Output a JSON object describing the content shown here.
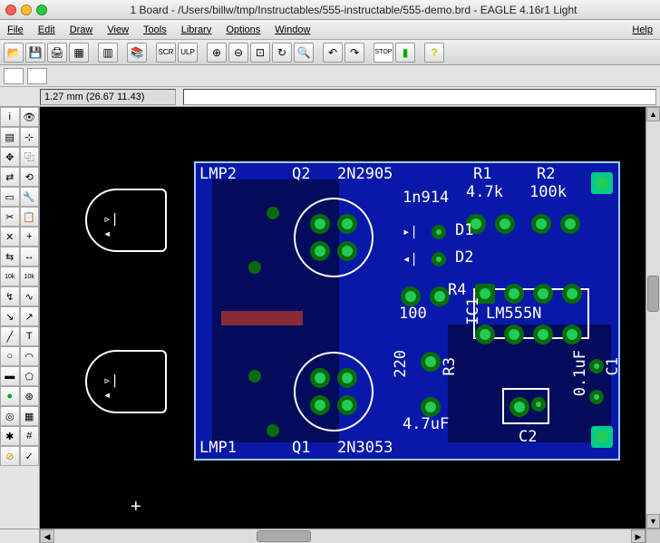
{
  "title": "1 Board - /Users/billw/tmp/Instructables/555-instructable/555-demo.brd - EAGLE 4.16r1 Light",
  "menu": {
    "file": "File",
    "edit": "Edit",
    "draw": "Draw",
    "view": "View",
    "tools": "Tools",
    "library": "Library",
    "options": "Options",
    "window": "Window",
    "help": "Help"
  },
  "coord": "1.27 mm (26.67 11.43)",
  "labels": {
    "lmp2": "LMP2",
    "lmp1": "LMP1",
    "q2": "Q2",
    "q2val": "2N2905",
    "q1": "Q1",
    "q1val": "2N3053",
    "r1": "R1",
    "r1val": "4.7k",
    "r2": "R2",
    "r2val": "100k",
    "r3": "R3",
    "r3val": "4.7uF",
    "r3num": "220",
    "r4": "R4",
    "r4val": "100",
    "d1": "D1",
    "d2": "D2",
    "d1val": "1n914",
    "ic1": "IC1",
    "icval": "LM555N",
    "c1": "C1",
    "c1val": "0.1uF",
    "c2": "C2"
  }
}
